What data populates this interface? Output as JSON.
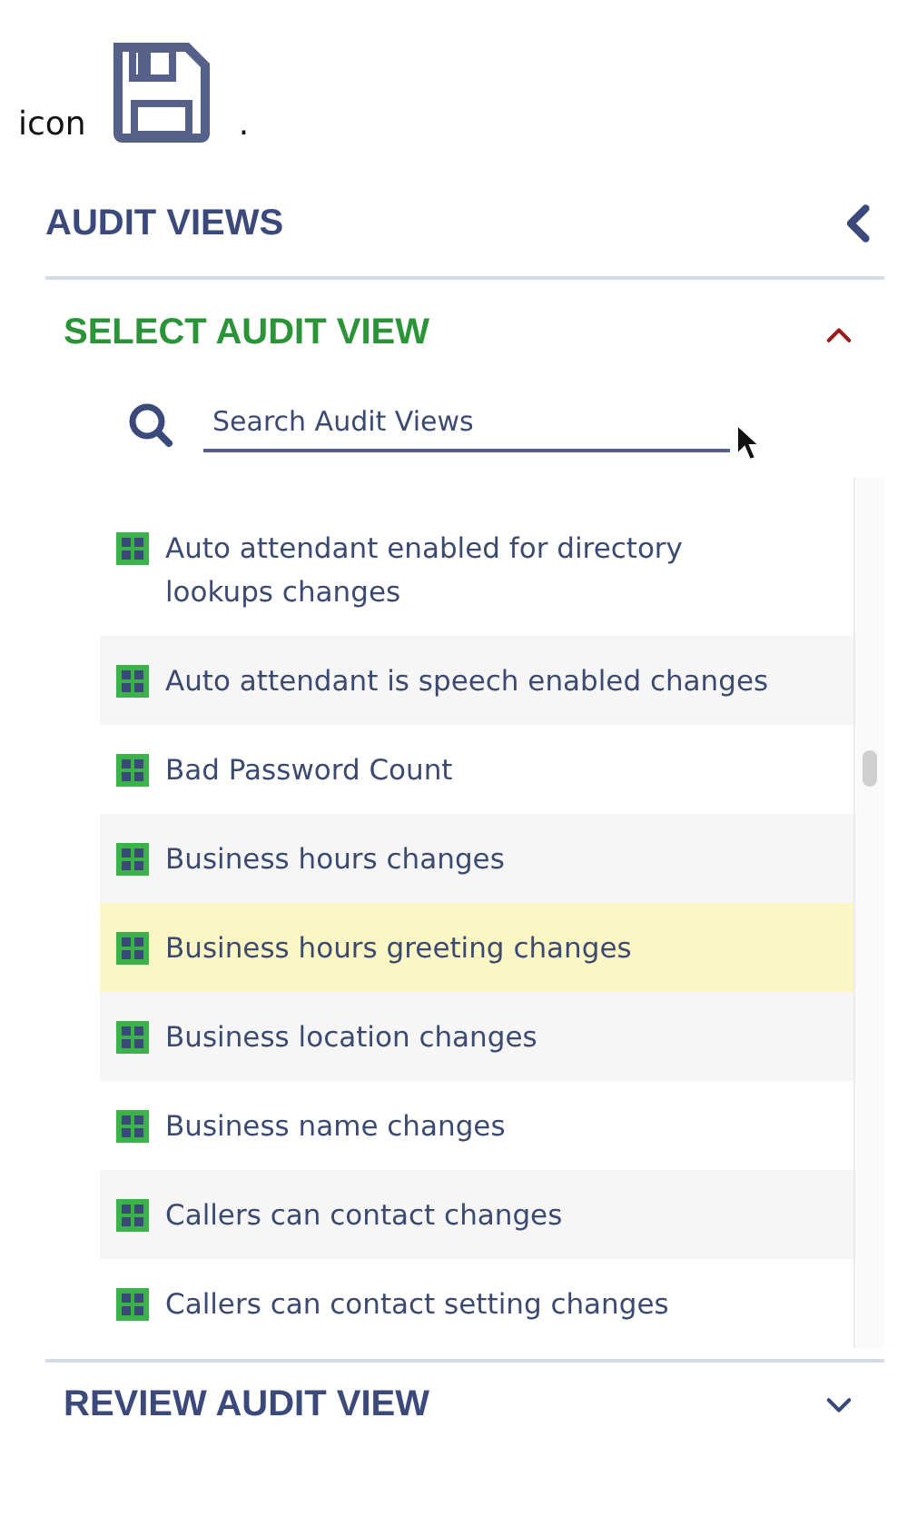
{
  "caption": {
    "before": "icon",
    "after": "."
  },
  "panel": {
    "title": "AUDIT VIEWS",
    "sections": [
      {
        "title": "SELECT AUDIT VIEW",
        "expanded": true,
        "search": {
          "placeholder": "Search Audit Views"
        },
        "items": [
          {
            "label": "Auto attendant enabled for directory lookups changes",
            "selected": false
          },
          {
            "label": "Auto attendant is speech enabled changes",
            "selected": false
          },
          {
            "label": "Bad Password Count",
            "selected": false
          },
          {
            "label": "Business hours changes",
            "selected": false
          },
          {
            "label": "Business hours greeting changes",
            "selected": true
          },
          {
            "label": "Business location changes",
            "selected": false
          },
          {
            "label": "Business name changes",
            "selected": false
          },
          {
            "label": "Callers can contact changes",
            "selected": false
          },
          {
            "label": "Callers can contact setting changes",
            "selected": false
          }
        ]
      },
      {
        "title": "REVIEW AUDIT VIEW",
        "expanded": false
      }
    ]
  }
}
